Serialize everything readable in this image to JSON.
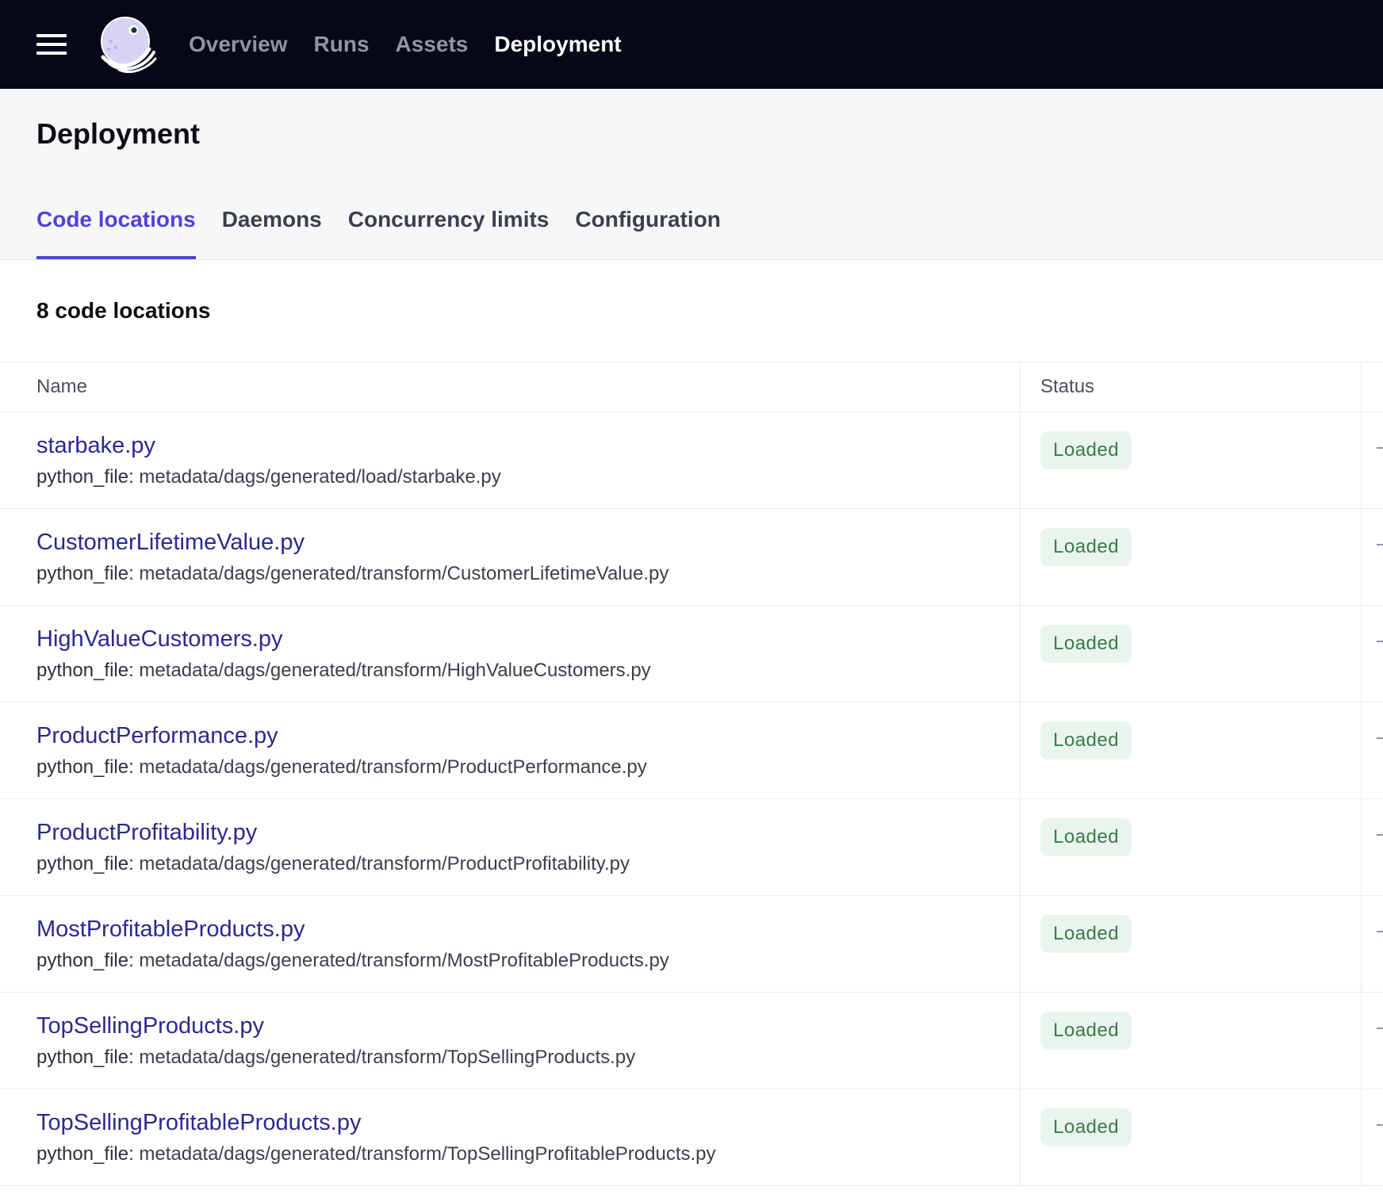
{
  "topbar": {
    "nav": [
      "Overview",
      "Runs",
      "Assets",
      "Deployment"
    ],
    "active_nav": "Deployment"
  },
  "page": {
    "title": "Deployment",
    "tabs": [
      "Code locations",
      "Daemons",
      "Concurrency limits",
      "Configuration"
    ],
    "active_tab": "Code locations"
  },
  "summary": {
    "count_text": "8 code locations"
  },
  "table": {
    "headers": {
      "name": "Name",
      "status": "Status"
    },
    "meta_key": "python_file:",
    "rows": [
      {
        "name": "starbake.py",
        "path": "metadata/dags/generated/load/starbake.py",
        "status": "Loaded"
      },
      {
        "name": "CustomerLifetimeValue.py",
        "path": "metadata/dags/generated/transform/CustomerLifetimeValue.py",
        "status": "Loaded"
      },
      {
        "name": "HighValueCustomers.py",
        "path": "metadata/dags/generated/transform/HighValueCustomers.py",
        "status": "Loaded"
      },
      {
        "name": "ProductPerformance.py",
        "path": "metadata/dags/generated/transform/ProductPerformance.py",
        "status": "Loaded"
      },
      {
        "name": "ProductProfitability.py",
        "path": "metadata/dags/generated/transform/ProductProfitability.py",
        "status": "Loaded"
      },
      {
        "name": "MostProfitableProducts.py",
        "path": "metadata/dags/generated/transform/MostProfitableProducts.py",
        "status": "Loaded"
      },
      {
        "name": "TopSellingProducts.py",
        "path": "metadata/dags/generated/transform/TopSellingProducts.py",
        "status": "Loaded"
      },
      {
        "name": "TopSellingProfitableProducts.py",
        "path": "metadata/dags/generated/transform/TopSellingProfitableProducts.py",
        "status": "Loaded"
      }
    ]
  },
  "colors": {
    "topbar_bg": "#050817",
    "accent": "#4f43dd",
    "link": "#2a2a8f",
    "badge_bg": "#e9f5ec",
    "badge_text": "#3b7a4c"
  },
  "icons": {
    "menu": "menu-icon",
    "logo": "dagster-logo"
  }
}
